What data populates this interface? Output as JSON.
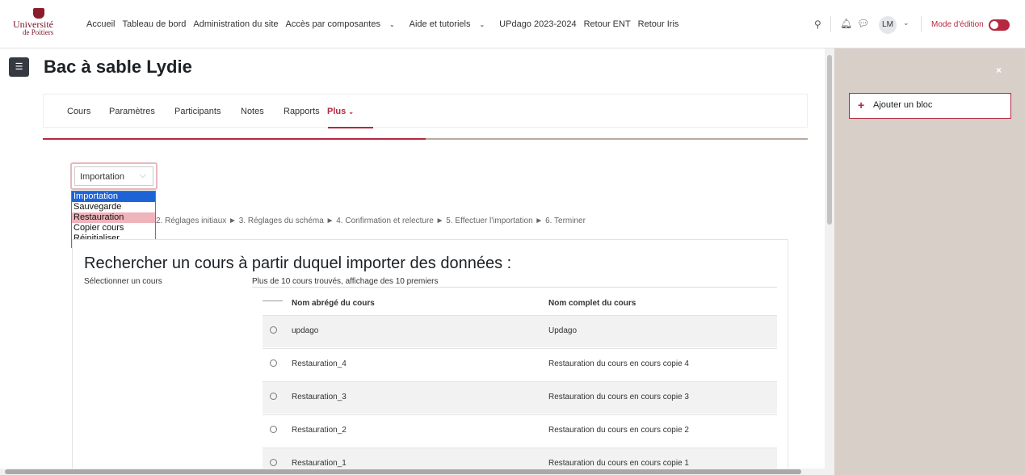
{
  "logo": {
    "line1": "Université",
    "line2": "de Poitiers"
  },
  "nav": {
    "links": [
      "Accueil",
      "Tableau de bord",
      "Administration du site",
      "Accès par composantes",
      "Aide et tutoriels",
      "UPdago 2023-2024",
      "Retour ENT",
      "Retour Iris"
    ],
    "dropdown_links": [
      3,
      4
    ],
    "avatar": "LM",
    "edit_mode_label": "Mode d'édition",
    "edit_mode_on": true,
    "accent_color": "#b5283f"
  },
  "page": {
    "title": "Bac à sable Lydie"
  },
  "secondary_nav": {
    "items": [
      "Cours",
      "Paramètres",
      "Participants",
      "Notes",
      "Rapports",
      "Plus"
    ],
    "active": "Plus"
  },
  "drawer": {
    "add_block": "Ajouter un bloc",
    "close": "×"
  },
  "import_select": {
    "value": "Importation",
    "options": [
      "Importation",
      "Sauvegarde",
      "Restauration",
      "Copier cours",
      "Réinitialiser"
    ],
    "selected": "Importation",
    "hovered": "Restauration"
  },
  "steps": "2. Réglages initiaux ► 3. Réglages du schéma ► 4. Confirmation et relecture ► 5. Effectuer l'importation ► 6. Terminer",
  "search": {
    "title": "Rechercher un cours à partir duquel importer des données :",
    "field_label": "Sélectionner un cours",
    "found_text": "Plus de 10 cours trouvés, affichage des 10 premiers",
    "columns": [
      "Nom abrégé du cours",
      "Nom complet du cours"
    ],
    "rows": [
      {
        "short": "updago",
        "full": "Updago"
      },
      {
        "short": "Restauration_4",
        "full": "Restauration du cours en cours copie 4"
      },
      {
        "short": "Restauration_3",
        "full": "Restauration du cours en cours copie 3"
      },
      {
        "short": "Restauration_2",
        "full": "Restauration du cours en cours copie 2"
      },
      {
        "short": "Restauration_1",
        "full": "Restauration du cours en cours copie 1"
      }
    ]
  }
}
